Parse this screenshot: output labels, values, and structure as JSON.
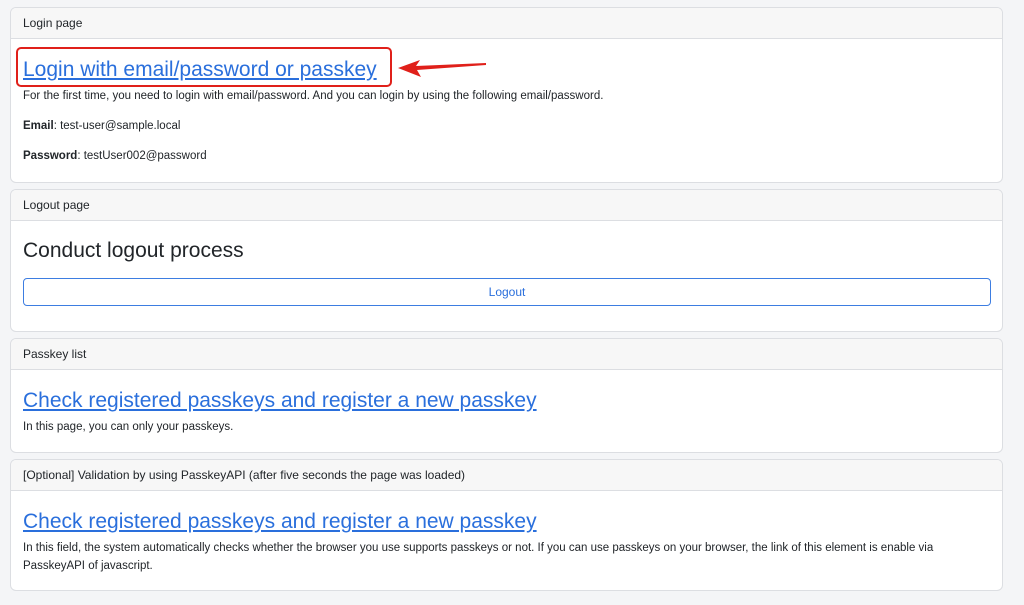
{
  "login": {
    "header": "Login page",
    "link": "Login with email/password or passkey",
    "note": "For the first time, you need to login with email/password. And you can login by using the following email/password.",
    "email_label": "Email",
    "email_value": ": test-user@sample.local",
    "password_label": "Password",
    "password_value": ": testUser002@password"
  },
  "logout": {
    "header": "Logout page",
    "title": "Conduct logout process",
    "button": "Logout"
  },
  "passkey_list": {
    "header": "Passkey list",
    "link": "Check registered passkeys and register a new passkey",
    "note": "In this page, you can only your passkeys."
  },
  "optional": {
    "header": "[Optional] Validation by using PasskeyAPI (after five seconds the page was loaded)",
    "link": "Check registered passkeys and register a new passkey",
    "note": "In this field, the system automatically checks whether the browser you use supports passkeys or not. If you can use passkeys on your browser, the link of this element is enable via PasskeyAPI of javascript."
  },
  "colors": {
    "link": "#2a6fdc",
    "annotation": "#e0201a"
  }
}
